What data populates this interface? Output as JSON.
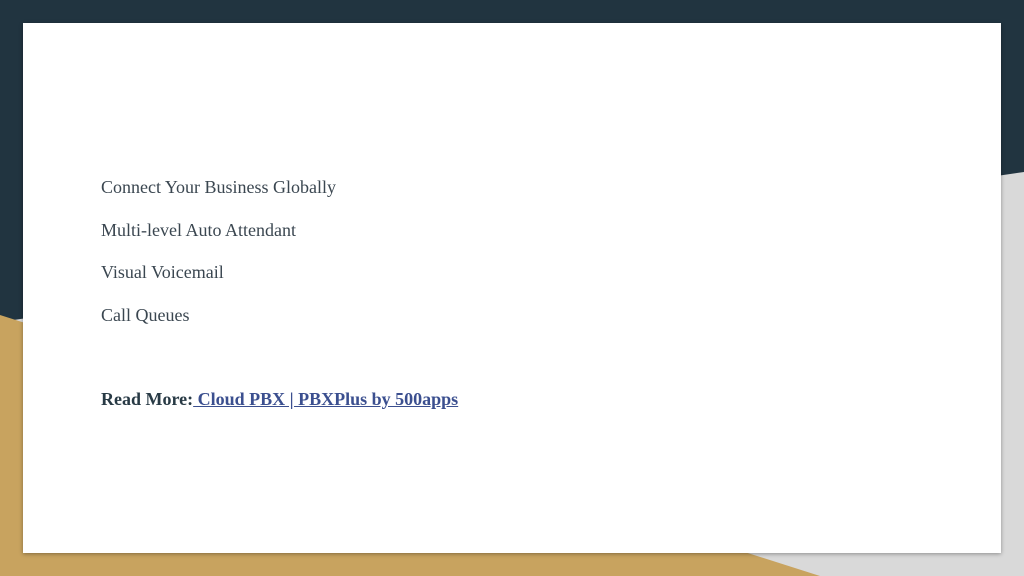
{
  "colors": {
    "dark_navy": "#213440",
    "gold": "#c8a35f",
    "light_gray": "#d9d9d9",
    "card": "#ffffff",
    "body_text": "#3a4650",
    "link": "#3b4f8f"
  },
  "features": [
    "Connect Your Business Globally",
    "Multi-level Auto Attendant",
    "Visual Voicemail",
    "Call Queues"
  ],
  "read_more": {
    "label": "Read More:",
    "link_text": " Cloud PBX | PBXPlus by 500apps"
  }
}
